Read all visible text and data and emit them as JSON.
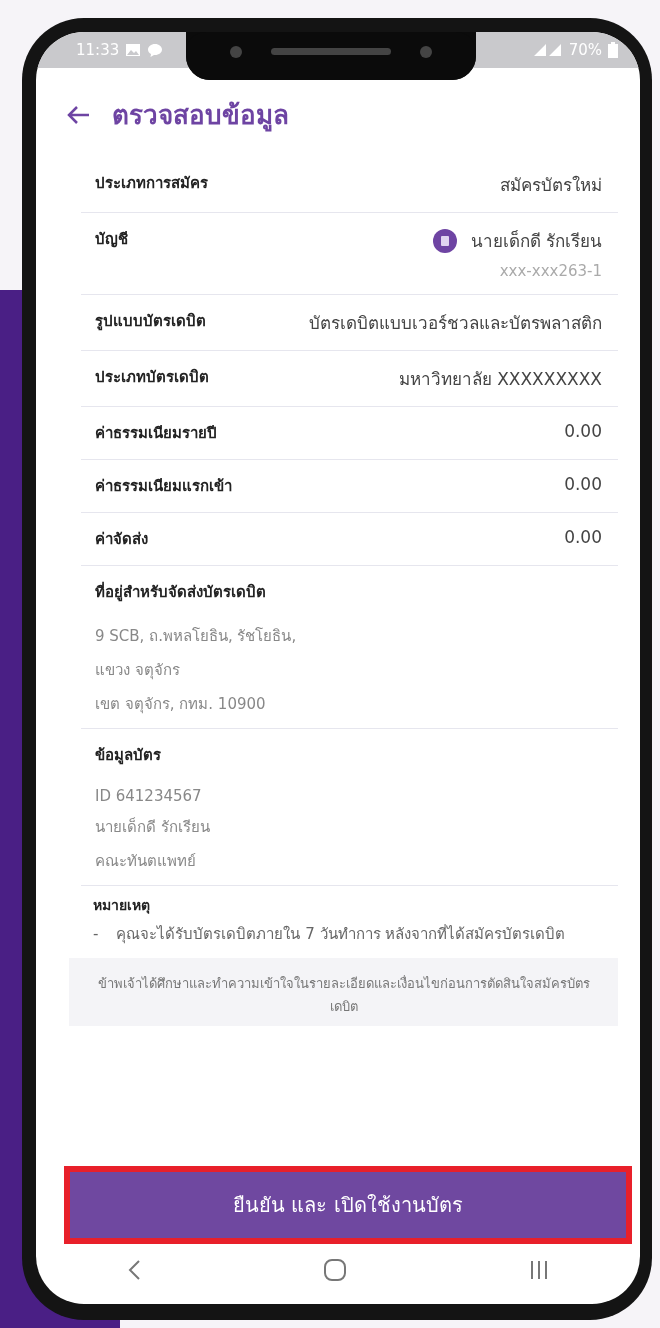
{
  "status_bar": {
    "time": "11:33",
    "battery": "70%"
  },
  "header": {
    "title": "ตรวจสอบข้อมูล"
  },
  "rows": [
    {
      "kind": "pair",
      "label": "ประเภทการสมัคร",
      "value": "สมัครบัตรใหม่"
    },
    {
      "kind": "account",
      "label": "บัญชี",
      "value": "นายเด็กดี รักเรียน",
      "sub": "xxx-xxx263-1"
    },
    {
      "kind": "pair",
      "label": "รูปแบบบัตรเดบิต",
      "value": "บัตรเดบิตแบบเวอร์ชวลและบัตรพลาสติก"
    },
    {
      "kind": "pair",
      "label": "ประเภทบัตรเดบิต",
      "value": "มหาวิทยาลัย XXXXXXXXX"
    },
    {
      "kind": "pair",
      "label": "ค่าธรรมเนียมรายปี",
      "value": "0.00"
    },
    {
      "kind": "pair",
      "label": "ค่าธรรมเนียมแรกเข้า",
      "value": "0.00"
    },
    {
      "kind": "pair",
      "label": "ค่าจัดส่ง",
      "value": "0.00"
    },
    {
      "kind": "block",
      "label": "ที่อยู่สำหรับจัดส่งบัตรเดบิต",
      "lines": [
        "9 SCB, ถ.พหลโยธิน, รัชโยธิน,",
        "แขวง จตุจักร",
        "เขต จตุจักร, กทม. 10900"
      ]
    },
    {
      "kind": "block",
      "label": "ข้อมูลบัตร",
      "lines": [
        "ID 641234567",
        "นายเด็กดี รักเรียน",
        "คณะทันตแพทย์"
      ]
    }
  ],
  "note": {
    "title": "หมายเหตุ",
    "bullet": "-",
    "text": "คุณจะได้รับบัตรเดบิตภายใน 7 วันทำการ หลังจากที่ได้สมัครบัตรเดบิต"
  },
  "consent": "ข้าพเจ้าได้ศึกษาและทำความเข้าใจในรายละเอียดและเงื่อนไขก่อนการตัดสินใจสมัครบัตรเดบิต",
  "confirm_button": {
    "label": "ยืนยัน และ เปิดใช้งานบัตร",
    "highlighted": true
  }
}
